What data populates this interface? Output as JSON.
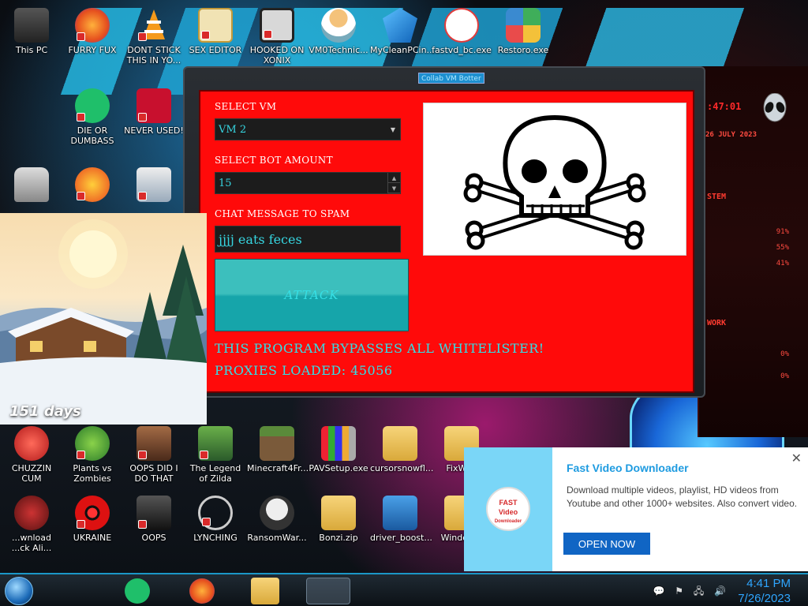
{
  "desktop_icons": [
    {
      "label": "This PC",
      "color": "#4a4a4a"
    },
    {
      "label": "FURRY FUX",
      "color": "#f36f20"
    },
    {
      "label": "DONT STICK THIS IN YO...",
      "color": "#f59a1b"
    },
    {
      "label": "SEX EDITOR",
      "color": "#e8c14a"
    },
    {
      "label": "HOOKED ON XONIX",
      "color": "#2a2a2a"
    },
    {
      "label": "VM0Technic...",
      "color": "#f4c27a"
    },
    {
      "label": "MyCleanPCin...",
      "color": "#1c8be0"
    },
    {
      "label": "fastvd_bc.exe",
      "color": "#e23b3b"
    },
    {
      "label": "Restoro.exe",
      "color": "#3fae5a"
    },
    {
      "label": "DIE OR DUMBASS",
      "color": "#1fbf6a"
    },
    {
      "label": "NEVER USED!",
      "color": "#c8102e"
    },
    {
      "label": "CHUZZIN CUM",
      "color": "#d9252a"
    },
    {
      "label": "Plants vs Zombies",
      "color": "#3aa83a"
    },
    {
      "label": "OOPS DID I DO THAT",
      "color": "#7a4a2a"
    },
    {
      "label": "The Legend of Zilda",
      "color": "#3a7a3a"
    },
    {
      "label": "Minecraft4Fr...",
      "color": "#6b4b2b"
    },
    {
      "label": "PAVSetup.exe",
      "color": "#d8a84a"
    },
    {
      "label": "cursorsnowfl...",
      "color": "#e8c060"
    },
    {
      "label": "FixWi...",
      "color": "#e8c060"
    },
    {
      "label": "...wnload ...ck Ali...",
      "color": "#7a1a1a"
    },
    {
      "label": "UKRAINE",
      "color": "#c01818"
    },
    {
      "label": "OOPS",
      "color": "#2a2a2a"
    },
    {
      "label": "LYNCHING",
      "color": "#bbbbbb"
    },
    {
      "label": "RansomWar...",
      "color": "#cccccc"
    },
    {
      "label": "Bonzi.zip",
      "color": "#e8c060"
    },
    {
      "label": "driver_boost...",
      "color": "#3a8ad0"
    },
    {
      "label": "Window...",
      "color": "#e8c060"
    }
  ],
  "app_window": {
    "title": "Collab VM Botter",
    "select_vm_label": "SELECT VM",
    "selected_vm": "VM 2",
    "bot_amount_label": "SELECT BOT AMOUNT",
    "bot_amount": "15",
    "chat_message_label": "CHAT MESSAGE TO SPAM",
    "chat_message": "jjjj eats feces",
    "attack_button": "ATTACK",
    "bypass_text": "THIS PROGRAM BYPASSES ALL WHITELISTER!",
    "proxies_text": "PROXIES LOADED: 45056"
  },
  "weather_widget": {
    "days": "151 days"
  },
  "notification": {
    "title": "Fast Video Downloader",
    "body": "Download multiple videos, playlist, HD videos from Youtube and other 1000+ websites. Also convert video.",
    "button": "OPEN NOW",
    "close": "✕",
    "logo_line1": "FAST",
    "logo_line2": "Video",
    "logo_line3": "Downloader"
  },
  "taskbar": {
    "time": "4:41 PM",
    "date": "7/26/2023"
  },
  "hud": {
    "time": ":47:01",
    "date": "26 JULY 2023",
    "system": "STEM",
    "pct1": "91%",
    "pct2": "55%",
    "pct3": "41%",
    "network": "WORK",
    "net1": "0%",
    "net2": "0%"
  },
  "colors": {
    "panel_red": "#ff0a0a",
    "field_text": "#36d5e0",
    "attack_teal": "#3cbfbd",
    "notif_blue": "#1e9be0",
    "clock_blue": "#2fa6ff"
  }
}
